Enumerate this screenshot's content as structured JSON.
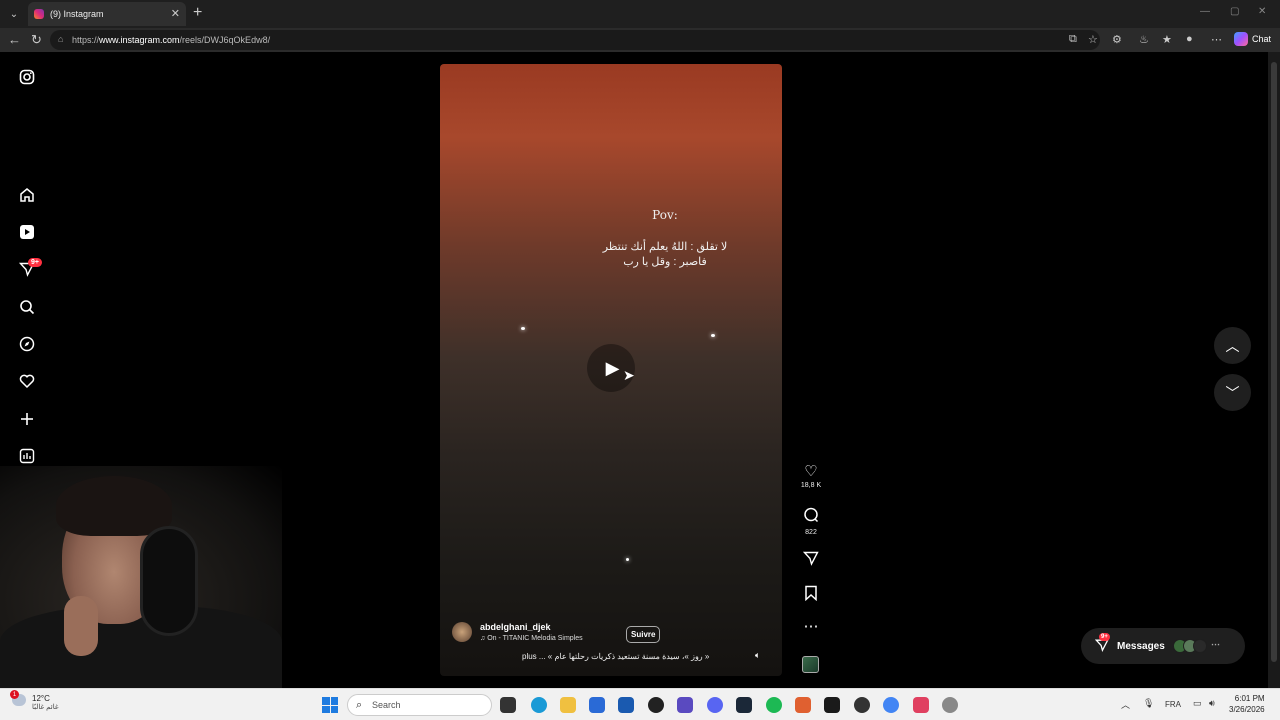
{
  "browser": {
    "tab_title": "(9) Instagram",
    "tab_close": "✕",
    "new_tab": "+",
    "url_prefix": "https://",
    "url_host": "www.instagram.com",
    "url_path": "/reels/DWJ6qOkEdw8/",
    "chat_label": "Chat"
  },
  "sidebar": {
    "notifications_badge": "9+"
  },
  "reel": {
    "pov": "Pov:",
    "arabic_line1": "لا تقلق : اللهُ يعلم أنك تنتظر",
    "arabic_line2": "فاصبر : وقل يا رب",
    "author": "abdelghani_djek",
    "music": "♫ On - TITANIC  Melodia Simples",
    "follow_label": "Suivre",
    "caption": "plus ... « روز »، سيدة مسنة تستعيد ذكريات رحلتها عام »"
  },
  "actions": {
    "likes": "18,8 K",
    "comments": "822"
  },
  "messages": {
    "label": "Messages",
    "badge": "9+"
  },
  "taskbar": {
    "temperature": "12°C",
    "weather_sub": "غائم غالبًا",
    "search_placeholder": "Search",
    "language": "FRA",
    "time": "6:01 PM",
    "date": "3/26/2026"
  },
  "colors": {
    "instagram_badge": "#ff3040",
    "accent_blue": "#1e7be0"
  }
}
